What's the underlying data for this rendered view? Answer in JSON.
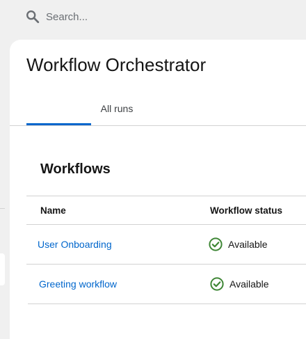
{
  "search": {
    "placeholder": "Search..."
  },
  "header": {
    "title": "Workflow Orchestrator"
  },
  "tabs": [
    {
      "label": "",
      "active": true
    },
    {
      "label": "All runs",
      "active": false
    }
  ],
  "section": {
    "title": "Workflows"
  },
  "table": {
    "columns": [
      "Name",
      "Workflow status"
    ],
    "rows": [
      {
        "name": "User Onboarding",
        "status": "Available"
      },
      {
        "name": "Greeting workflow",
        "status": "Available"
      }
    ]
  },
  "colors": {
    "link": "#0066cc",
    "success": "#3e8635",
    "tab_active": "#0066cc"
  },
  "icons": {
    "search": "search-icon",
    "status": "check-circle-icon"
  }
}
